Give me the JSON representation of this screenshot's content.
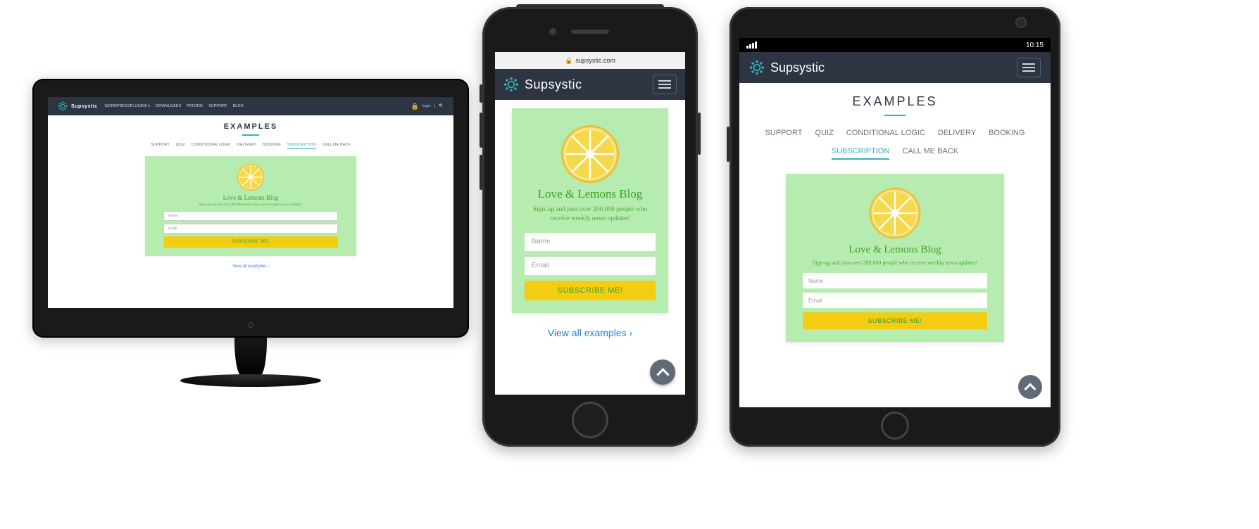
{
  "brand": "Supsystic",
  "url_host": "supsystic.com",
  "status_time": "10:15",
  "desktop_nav": {
    "items": [
      "WORDPRESSPLUGINS ▾",
      "DOWNLOADS",
      "PRICING",
      "SUPPORT",
      "BLOG"
    ],
    "right_login": "login",
    "right_sep": "|"
  },
  "page_title": "EXAMPLES",
  "tabs": {
    "items": [
      "SUPPORT",
      "QUIZ",
      "CONDITIONAL LOGIC",
      "DELIVERY",
      "BOOKING",
      "SUBSCRIPTION",
      "CALL ME BACK"
    ],
    "active_index": 5
  },
  "form": {
    "heading": "Love & Lemons Blog",
    "sub_desktop": "Sign-up and join over 200,000 people who receive weekly news updates!",
    "sub_phone": "Sign-up and join over 200,000 people who receive weekly news updates!",
    "sub_tablet": "Sign-up and join over 200,000 people who receive weekly news updates!",
    "name_placeholder": "Name",
    "email_placeholder": "Email",
    "submit_label": "SUBSCRIBE ME!"
  },
  "view_all": {
    "desktop": "View all examples ›",
    "phone": "View all examples ›"
  },
  "colors": {
    "header": "#2d3543",
    "accent": "#36b0b7",
    "card_bg": "#b7ecb0",
    "btn": "#f4cc12",
    "link": "#2a7fd6",
    "form_text": "#3fa02b"
  }
}
